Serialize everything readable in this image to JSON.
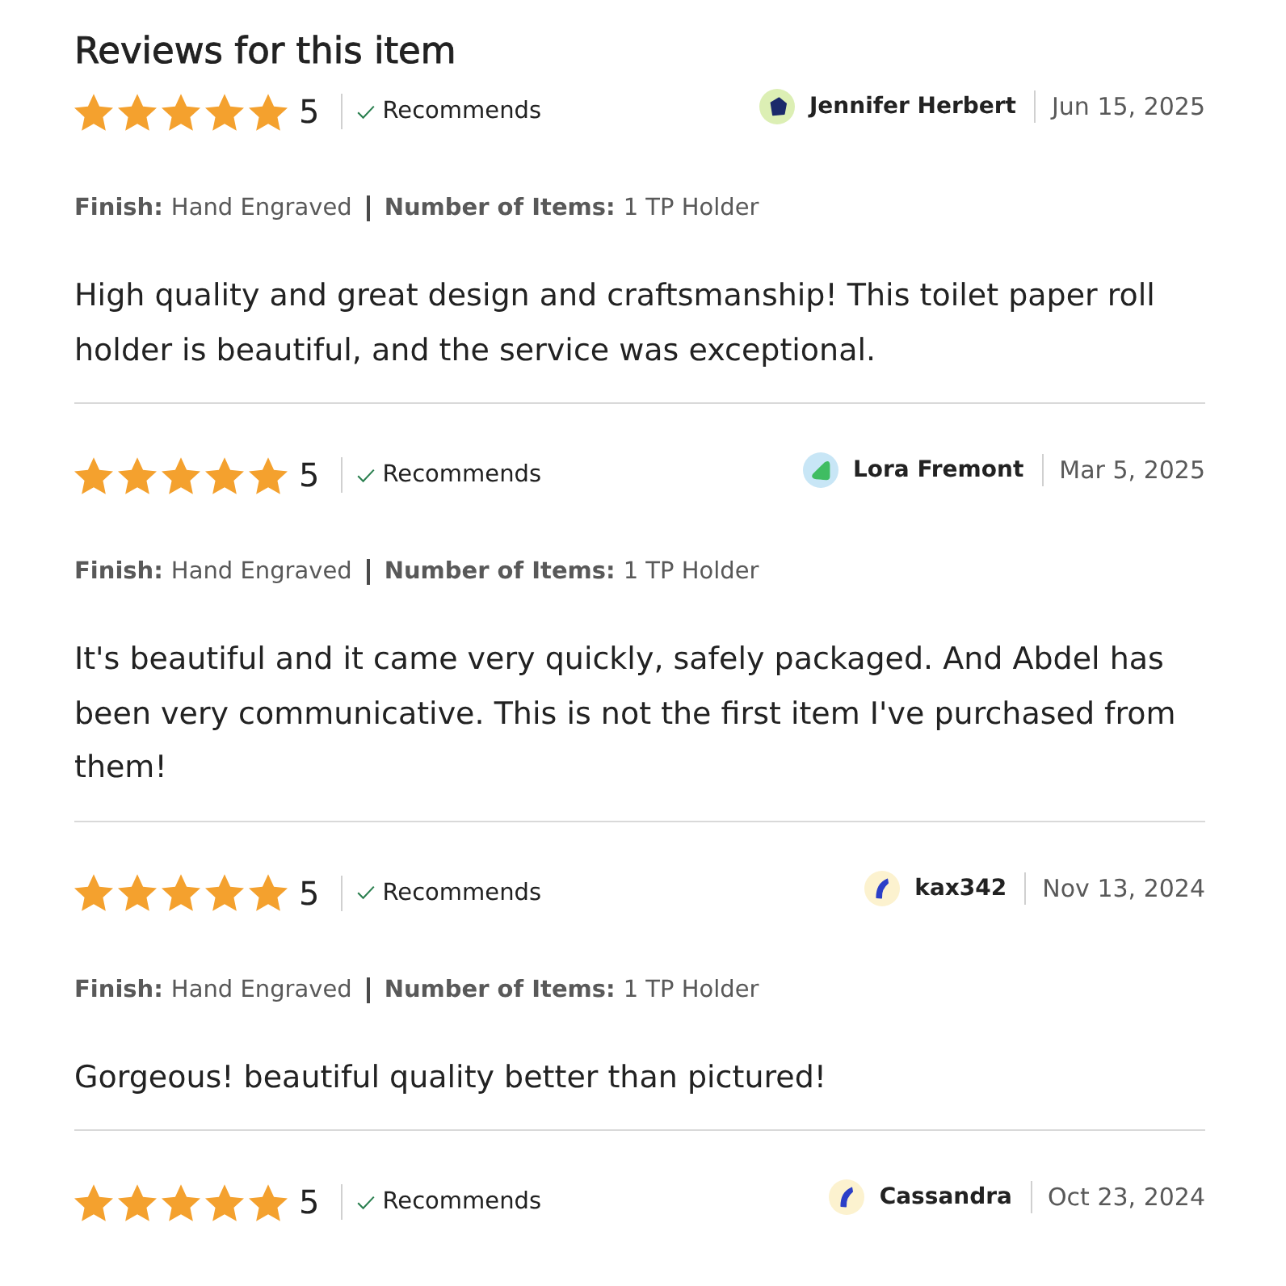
{
  "title": "Reviews for this item",
  "reviews": [
    {
      "stars": 5,
      "rating": "5",
      "recommendation": "Recommends",
      "reviewer": {
        "name": "Jennifer Herbert",
        "avatar": {
          "kind": "pentagon"
        }
      },
      "date": "Jun 15, 2025",
      "variations": [
        {
          "label": "Finish:",
          "value": "Hand Engraved"
        },
        {
          "label": "Number of Items:",
          "value": "1 TP Holder"
        }
      ],
      "text": "High quality and great design and craftsmanship! This toilet paper roll holder is beautiful, and the service was exceptional."
    },
    {
      "stars": 5,
      "rating": "5",
      "recommendation": "Recommends",
      "reviewer": {
        "name": "Lora Fremont",
        "avatar": {
          "kind": "leaf"
        }
      },
      "date": "Mar 5, 2025",
      "variations": [
        {
          "label": "Finish:",
          "value": "Hand Engraved"
        },
        {
          "label": "Number of Items:",
          "value": "1 TP Holder"
        }
      ],
      "text": "It's beautiful and it came very quickly, safely packaged. And Abdel has been very communicative. This is not the first item I've purchased from them!"
    },
    {
      "stars": 5,
      "rating": "5",
      "recommendation": "Recommends",
      "reviewer": {
        "name": "kax342",
        "avatar": {
          "kind": "crescent"
        }
      },
      "date": "Nov 13, 2024",
      "variations": [
        {
          "label": "Finish:",
          "value": "Hand Engraved"
        },
        {
          "label": "Number of Items:",
          "value": "1 TP Holder"
        }
      ],
      "text": "Gorgeous! beautiful quality better than pictured!"
    },
    {
      "stars": 5,
      "rating": "5",
      "recommendation": "Recommends",
      "reviewer": {
        "name": "Cassandra",
        "avatar": {
          "kind": "crescent"
        }
      },
      "date": "Oct 23, 2024"
    }
  ]
}
